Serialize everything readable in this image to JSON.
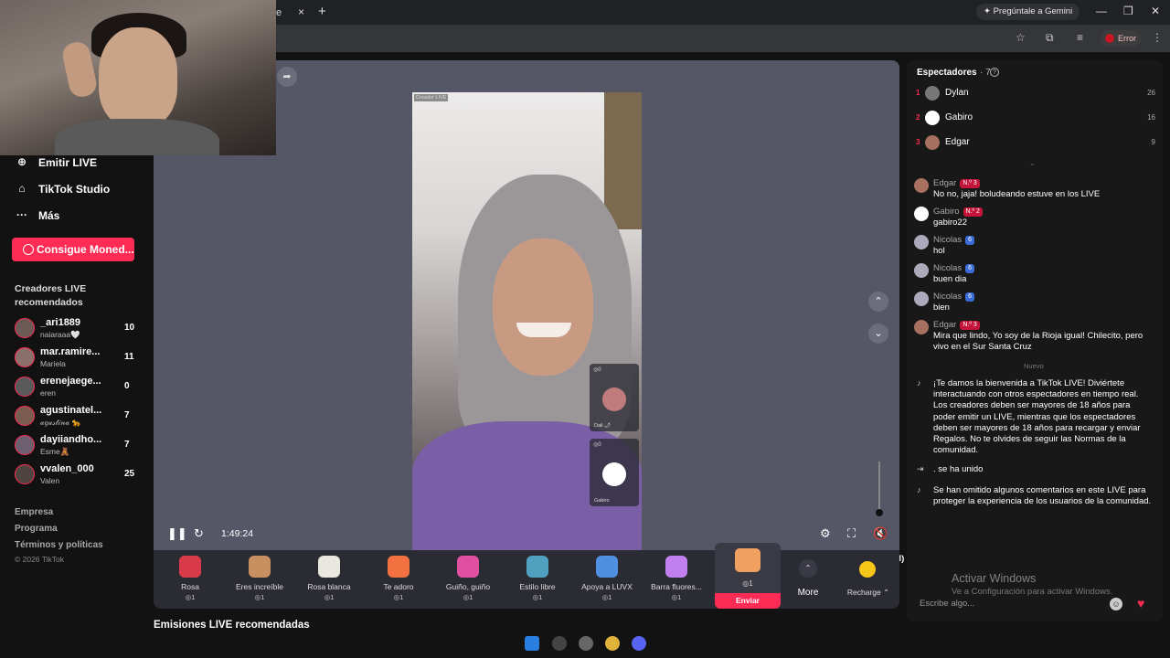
{
  "browser": {
    "tab_title": "e",
    "tab_close": "×",
    "new_tab": "+",
    "gemini_label": "✦ Pregúntale a Gemini",
    "win_min": "—",
    "win_max": "❐",
    "win_close": "✕",
    "error_label": "Error"
  },
  "sidebar": {
    "items": [
      {
        "icon": "⊕",
        "label": "Emitir LIVE"
      },
      {
        "icon": "⌂",
        "label": "TikTok Studio"
      },
      {
        "icon": "···",
        "label": "Más"
      }
    ],
    "coins_button": "Consigue Moned...",
    "recommended_title": "Creadores LIVE recomendados",
    "creators": [
      {
        "name": "_ari1889",
        "sub": "naiaraaa🤍",
        "count": "10"
      },
      {
        "name": "mar.ramire...",
        "sub": "Mariela",
        "count": "11"
      },
      {
        "name": "erenejaege...",
        "sub": "eren",
        "count": "0"
      },
      {
        "name": "agustinatel...",
        "sub": "𝒶𝑔𝓊𝓈𝓉𝒾𝓃𝒶 🐆",
        "count": "7"
      },
      {
        "name": "dayiiandho...",
        "sub": "Esme🧸",
        "count": "7"
      },
      {
        "name": "vvalen_000",
        "sub": "Valen",
        "count": "25"
      }
    ],
    "footer": [
      "Empresa",
      "Programa",
      "Términos y políticas"
    ],
    "copyright": "© 2026 TikTok"
  },
  "player": {
    "creator_tag": "Creador LIVE",
    "guests": [
      {
        "coins": "◎0",
        "name": "Dali 🌶"
      },
      {
        "coins": "◎0",
        "name": "Gabiro"
      }
    ],
    "time": "1:49:24",
    "mute_tooltip": "Silenciar (M)",
    "up_arrow": "⌃",
    "down_arrow": "⌄"
  },
  "gifts": [
    {
      "name": "Rosa",
      "price": "◎1",
      "color": "#d83a4a"
    },
    {
      "name": "Eres increíble",
      "price": "◎1",
      "color": "#c89060"
    },
    {
      "name": "Rosa blanca",
      "price": "◎1",
      "color": "#e8e8e0"
    },
    {
      "name": "Te adoro",
      "price": "◎1",
      "color": "#f07040"
    },
    {
      "name": "Guiño, guiño",
      "price": "◎1",
      "color": "#e050a0"
    },
    {
      "name": "Estilo libre",
      "price": "◎1",
      "color": "#50a0c0"
    },
    {
      "name": "Apoya a LUVX",
      "price": "◎1",
      "color": "#5090e0"
    },
    {
      "name": "Barra fluores...",
      "price": "◎1",
      "color": "#c080f0"
    }
  ],
  "selected_gift": {
    "price": "◎1",
    "send_label": "Enviar"
  },
  "more_label": "More",
  "recharge_label": "Recharge ⌃",
  "below_title": "Emisiones LIVE recomendadas",
  "chat": {
    "viewers_title": "Espectadores",
    "viewers_count": "· 7",
    "viewers": [
      {
        "rank": "1",
        "name": "Dylan",
        "score": "26",
        "color": "#777"
      },
      {
        "rank": "2",
        "name": "Gabiro",
        "score": "16",
        "color": "#ffffff"
      },
      {
        "rank": "3",
        "name": "Edgar",
        "score": "9",
        "color": "#a87060"
      }
    ],
    "messages": [
      {
        "user": "Edgar",
        "badge": "N.º 3",
        "badge_type": "red",
        "text": "No no, jaja! boludeando estuve en los LIVE",
        "color": "#a87060"
      },
      {
        "user": "Gabiro",
        "badge": "N.º 2",
        "badge_type": "red",
        "text": "gabiro22",
        "color": "#ffffff"
      },
      {
        "user": "Nicolas",
        "badge": "6",
        "badge_type": "blue",
        "text": "hol",
        "color": "#aab"
      },
      {
        "user": "Nicolas",
        "badge": "6",
        "badge_type": "blue",
        "text": "buen dia",
        "color": "#aab"
      },
      {
        "user": "Nicolas",
        "badge": "6",
        "badge_type": "blue",
        "text": "bien",
        "color": "#aab"
      },
      {
        "user": "Edgar",
        "badge": "N.º 3",
        "badge_type": "red",
        "text": "Mira que lindo, Yo soy de la Rioja igual! Chilecito, pero vivo en el Sur Santa Cruz",
        "color": "#a87060"
      }
    ],
    "new_label": "Nuevo",
    "system": [
      "¡Te damos la bienvenida a TikTok LIVE! Diviértete interactuando con otros espectadores en tiempo real. Los creadores deben ser mayores de 18 años para poder emitir un LIVE, mientras que los espectadores deben ser mayores de 18 años para recargar y enviar Regalos. No te olvides de seguir las Normas de la comunidad.",
      ". se ha unido",
      "Se han omitido algunos comentarios en este LIVE para proteger la experiencia de los usuarios de la comunidad."
    ],
    "watermark_title": "Activar Windows",
    "watermark_sub": "Ve a Configuración para activar Windows.",
    "input_placeholder": "Escribe algo..."
  }
}
